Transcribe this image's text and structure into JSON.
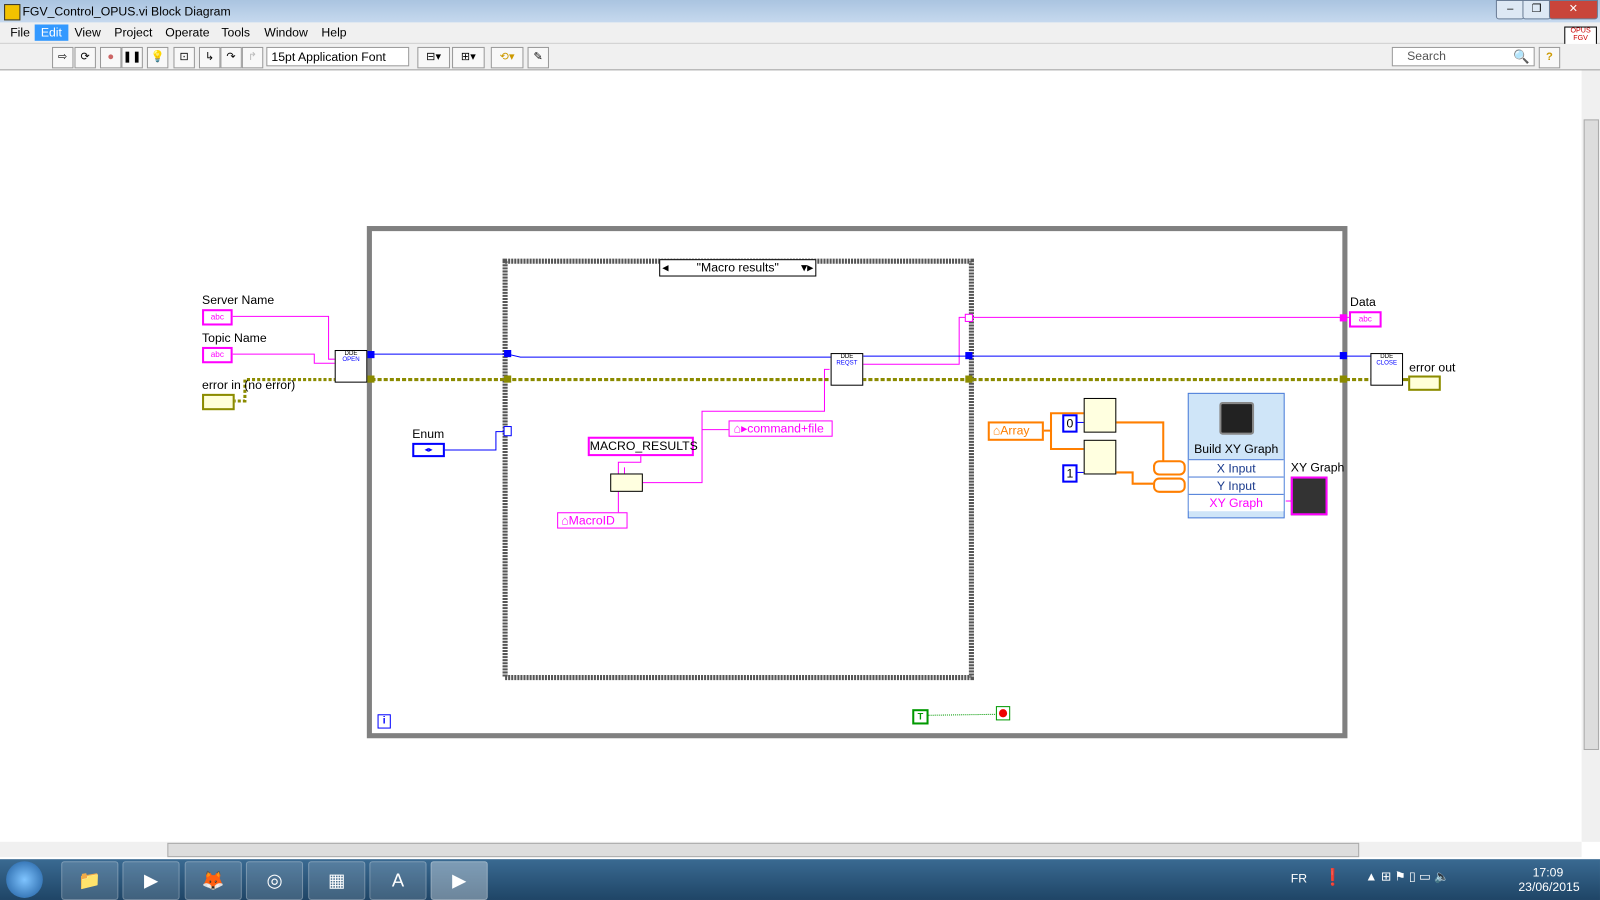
{
  "window": {
    "title": "FGV_Control_OPUS.vi Block Diagram",
    "min": "–",
    "restore": "❐",
    "close": "✕"
  },
  "menu": [
    "File",
    "Edit",
    "View",
    "Project",
    "Operate",
    "Tools",
    "Window",
    "Help"
  ],
  "menu_active": "Edit",
  "toolbar": {
    "font": "15pt Application Font",
    "search_placeholder": "Search",
    "help": "?",
    "vi_icon": "OPUS FGV"
  },
  "diagram": {
    "controls": {
      "server_name": "Server Name",
      "topic_name": "Topic Name",
      "error_in": "error in (no error)",
      "enum": "Enum",
      "data": "Data",
      "error_out": "error out",
      "xy_graph": "XY Graph",
      "abc": "abc"
    },
    "case_selector": "\"Macro results\"",
    "constants": {
      "macro_results": "MACRO_RESULTS",
      "command_file": "command+file",
      "macro_id": "MacroID",
      "array": "Array",
      "index0": "0",
      "index1": "1",
      "loop_true": "T",
      "iteration": "i"
    },
    "dde_nodes": {
      "open": "OPEN",
      "reqst": "REQST",
      "close": "CLOSE",
      "dde": "DDE"
    },
    "express_vi": {
      "title": "Build XY Graph",
      "inputs": [
        "X Input",
        "Y Input"
      ],
      "output": "XY Graph"
    }
  },
  "taskbar": {
    "lang": "FR",
    "time": "17:09",
    "date": "23/06/2015"
  },
  "colors": {
    "string_wire": "#ff00ff",
    "dde_wire": "#0000ff",
    "error_wire": "#8b8b00",
    "array_wire": "#ff7f00",
    "loop_border": "#808080",
    "accent": "#3399ff"
  }
}
